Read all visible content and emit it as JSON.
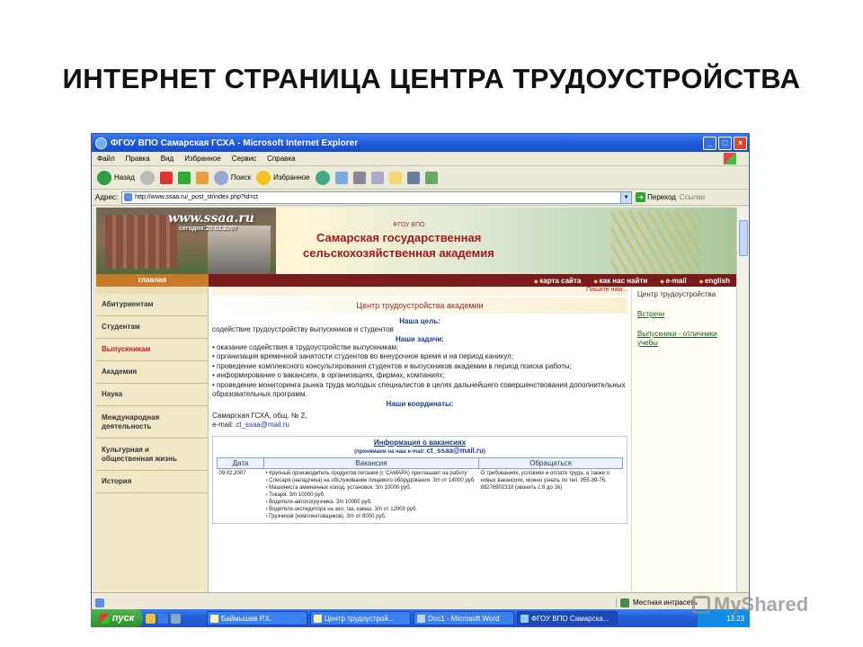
{
  "slide": {
    "title": "ИНТЕРНЕТ СТРАНИЦА ЦЕНТРА ТРУДОУСТРОЙСТВА"
  },
  "window": {
    "title": "ФГОУ ВПО Самарская ГСХА - Microsoft Internet Explorer",
    "controls": {
      "minimize": "_",
      "maximize": "□",
      "close": "×"
    }
  },
  "menu": [
    "Файл",
    "Правка",
    "Вид",
    "Избранное",
    "Сервис",
    "Справка"
  ],
  "toolbar": {
    "back": "Назад",
    "search": "Поиск",
    "favorites": "Избранное"
  },
  "address": {
    "label": "Адрес:",
    "url": "http://www.ssaa.ru/_post_st/index.php?id=ct",
    "go": "Переход",
    "links": "Ссылки"
  },
  "banner": {
    "site": "www.ssaa.ru",
    "date": "сегодня:20.02.2007",
    "org_type": "ФГОУ ВПО",
    "name_line1": "Самарская государственная",
    "name_line2": "сельскохозяйственная академия"
  },
  "nav": {
    "home": "главная",
    "links": [
      "карта сайта",
      "как нас найти",
      "e-mail",
      "english"
    ]
  },
  "left_menu": [
    {
      "label": "Абитуриентам"
    },
    {
      "label": "Студентам"
    },
    {
      "label": "Выпускникам"
    },
    {
      "label": "Академия"
    },
    {
      "label": "Наука"
    },
    {
      "label": "Международная деятельность"
    },
    {
      "label": "Культурная и общественная жизнь"
    },
    {
      "label": "История"
    }
  ],
  "center": {
    "write_us": "Пишите нам...",
    "title": "Центр трудоустройства академии",
    "goal_heading": "Наша цель:",
    "goal_text": "содействие трудоустройству выпускников и студентов",
    "tasks_heading": "Наши задачи:",
    "tasks": [
      "• оказание содействия в трудоустройстве выпускникам;",
      "• организация временной занятости студентов во внеурочное время и на период каникул;",
      "• проведение комплексного консультирования студентов и выпускников академии в период поиска работы;",
      "• информирование о вакансиях, в организациях, фирмах, компаниях;",
      "• проведение мониторинга рынка труда молодых специалистов в целях дальнейшего совершенствования дополнительных образовательных программ."
    ],
    "coords_heading": "Наши координаты:",
    "address_line": "Самарская ГСХА, общ. № 2,",
    "email_label": "e-mail:",
    "email": "ct_ssaa@mail.ru"
  },
  "vacancies": {
    "title": "Информация о вакансиях",
    "subtitle": "(принимаем на наш e-mail:",
    "email": "ct_ssaa@mail.ru",
    "subtitle_end": ")",
    "columns": [
      "Дата",
      "Вакансия",
      "Обращаться"
    ],
    "row": {
      "date": "09.02.2007",
      "vacancy_lines": [
        "• Крупный производитель продуктов питания (г. САМАРА) приглашает на работу:",
        "› Слесаря (наладчика) на обслуживание пищевого оборудования. З/п от 14000 руб.",
        "› Машиниста аммиачных холод. установок. З/п 10000 руб.",
        "› Токаря. З/п 10000 руб.",
        "› Водителя-автопогрузчика. З/п 10000 руб.",
        "› Водителя-экспедитора на зил, газ, камаз. З/п от 12000 руб.",
        "› Грузчиков (комплектовщиков). З/п от 8000 руб."
      ],
      "contact": "О требованиях, условиях и оплате труда, а также о новых вакансиях, можно узнать по тел. 955-39-76, 89276902310 (звонить с 8 до 16)"
    }
  },
  "right_menu": {
    "header": "Центр трудоустройства",
    "links": [
      "Встречи",
      "Выпускники - отличники учебы"
    ]
  },
  "status": {
    "zone": "Местная интрасеть"
  },
  "taskbar": {
    "start": "пуск",
    "items": [
      "Баймышев Р.Х.",
      "Центр трудоустрой...",
      "Doc1 - Microsoft Word",
      "ФГОУ ВПО Самарска..."
    ],
    "clock": "13:23"
  },
  "watermark": "MyShared"
}
